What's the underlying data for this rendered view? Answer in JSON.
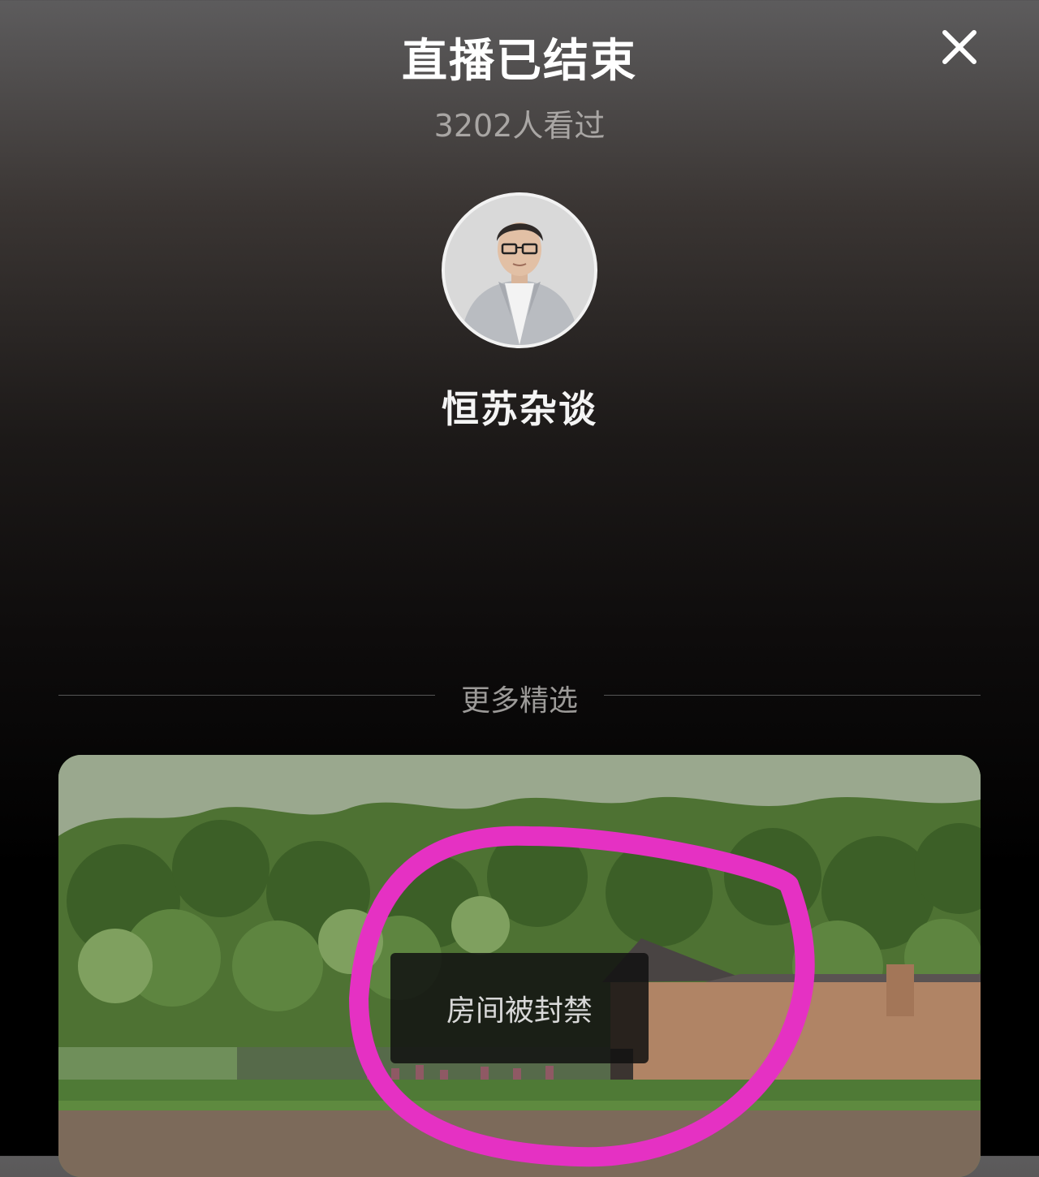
{
  "header": {
    "title": "直播已结束",
    "close_icon": "close-icon"
  },
  "stats": {
    "viewers": "3202人看过"
  },
  "host": {
    "name": "恒苏杂谈",
    "avatar_icon": "avatar"
  },
  "more_section": {
    "label": "更多精选"
  },
  "recommended_card": {
    "overlay_text": "房间被封禁",
    "annotation_color": "#e531c3"
  },
  "colors": {
    "title": "#ffffff",
    "secondary_text": "#a9a6a4",
    "background_bottom": "#000000"
  }
}
